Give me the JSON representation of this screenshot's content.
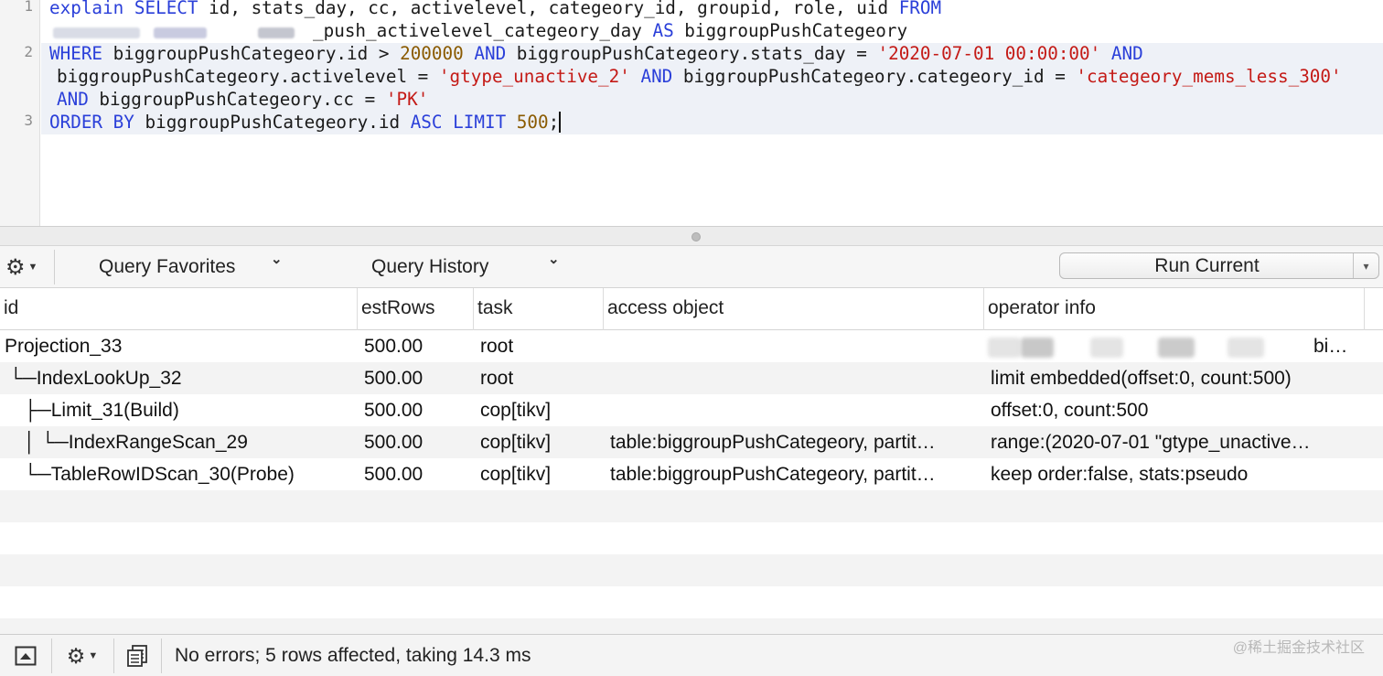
{
  "editor": {
    "line_numbers": [
      "1",
      "2",
      "3"
    ],
    "line1_parts": [
      {
        "t": "explain ",
        "c": "kw"
      },
      {
        "t": "SELECT",
        "c": "kw"
      },
      {
        "t": " id, stats_day, cc, activelevel, categeory_id, groupid, role, uid ",
        "c": ""
      },
      {
        "t": "FROM",
        "c": "kw"
      }
    ],
    "line1b_parts": [
      {
        "t": "_push_activelevel_categeory_day ",
        "c": ""
      },
      {
        "t": "AS",
        "c": "kw"
      },
      {
        "t": " biggroupPushCategeory",
        "c": ""
      }
    ],
    "line2_parts": [
      {
        "t": "WHERE",
        "c": "kw"
      },
      {
        "t": " biggroupPushCategeory.id > ",
        "c": ""
      },
      {
        "t": "200000",
        "c": "num"
      },
      {
        "t": " ",
        "c": ""
      },
      {
        "t": "AND",
        "c": "kw"
      },
      {
        "t": " biggroupPushCategeory.stats_day = ",
        "c": ""
      },
      {
        "t": "'2020-07-01 00:00:00'",
        "c": "str"
      },
      {
        "t": " ",
        "c": ""
      },
      {
        "t": "AND",
        "c": "kw"
      }
    ],
    "line2b_parts": [
      {
        "t": "biggroupPushCategeory.activelevel = ",
        "c": ""
      },
      {
        "t": "'gtype_unactive_2'",
        "c": "str"
      },
      {
        "t": " ",
        "c": ""
      },
      {
        "t": "AND",
        "c": "kw"
      },
      {
        "t": " biggroupPushCategeory.categeory_id = ",
        "c": ""
      },
      {
        "t": "'categeory_mems_less_300'",
        "c": "str"
      }
    ],
    "line2c_parts": [
      {
        "t": "AND",
        "c": "kw"
      },
      {
        "t": " biggroupPushCategeory.cc = ",
        "c": ""
      },
      {
        "t": "'PK'",
        "c": "str"
      }
    ],
    "line3_parts": [
      {
        "t": "ORDER BY",
        "c": "kw"
      },
      {
        "t": " biggroupPushCategeory.id ",
        "c": ""
      },
      {
        "t": "ASC",
        "c": "kw"
      },
      {
        "t": " ",
        "c": ""
      },
      {
        "t": "LIMIT",
        "c": "kw"
      },
      {
        "t": " ",
        "c": ""
      },
      {
        "t": "500",
        "c": "num"
      },
      {
        "t": ";",
        "c": "caret"
      }
    ]
  },
  "toolbar": {
    "settings_icon": "gear-icon",
    "query_favorites_label": "Query Favorites",
    "query_history_label": "Query History",
    "run_current_label": "Run Current",
    "chevron": "⌄"
  },
  "grid": {
    "columns": [
      "id",
      "estRows",
      "task",
      "access object",
      "operator info"
    ],
    "rows": [
      {
        "id": "Projection_33",
        "estRows": "500.00",
        "task": "root",
        "access": "",
        "info": "bi…"
      },
      {
        "id": "└─IndexLookUp_32",
        "estRows": "500.00",
        "task": "root",
        "access": "",
        "info": "limit embedded(offset:0, count:500)"
      },
      {
        "id": "├─Limit_31(Build)",
        "estRows": "500.00",
        "task": "cop[tikv]",
        "access": "",
        "info": "offset:0, count:500"
      },
      {
        "id": "│ └─IndexRangeScan_29",
        "estRows": "500.00",
        "task": "cop[tikv]",
        "access": "table:biggroupPushCategeory, partit…",
        "info": "range:(2020-07-01 \"gtype_unactive…"
      },
      {
        "id": "└─TableRowIDScan_30(Probe)",
        "estRows": "500.00",
        "task": "cop[tikv]",
        "access": "table:biggroupPushCategeory, partit…",
        "info": "keep order:false, stats:pseudo"
      }
    ]
  },
  "status": {
    "message": "No errors; 5 rows affected, taking 14.3 ms",
    "watermark": "@稀土掘金技术社区",
    "icons": [
      "panel-toggle-icon",
      "gear-icon",
      "copy-icon"
    ]
  }
}
